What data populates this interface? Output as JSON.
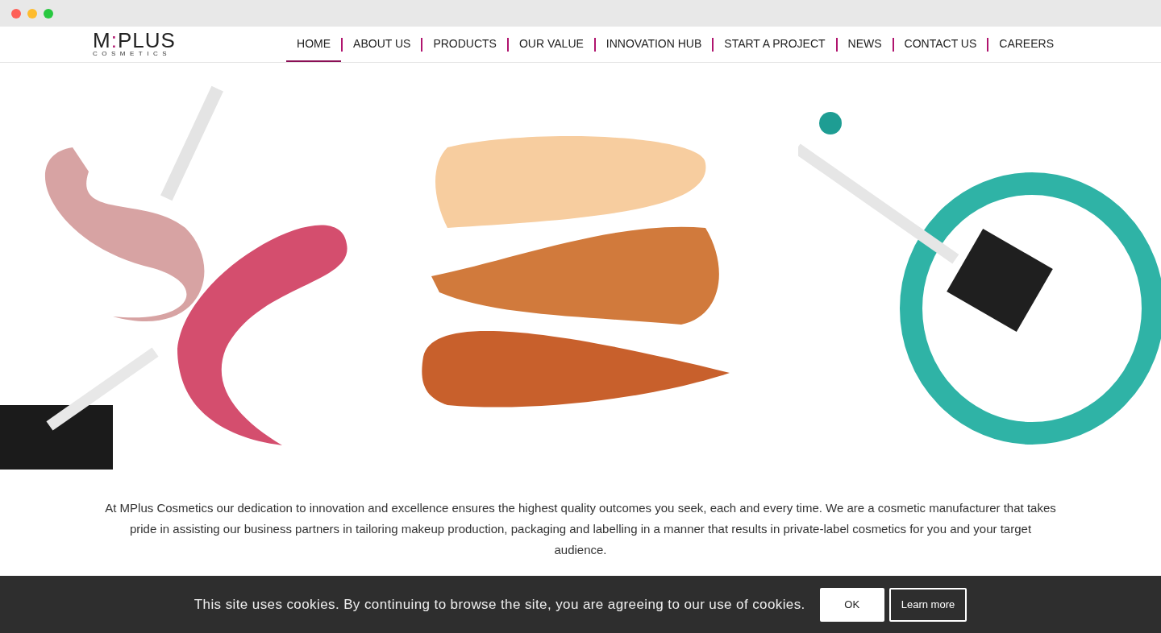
{
  "logo": {
    "name": "M:PLUS",
    "tagline": "COSMETICS"
  },
  "nav": [
    {
      "label": "HOME",
      "selected": true
    },
    {
      "label": "ABOUT US",
      "selected": false
    },
    {
      "label": "PRODUCTS",
      "selected": false
    },
    {
      "label": "OUR VALUE",
      "selected": false
    },
    {
      "label": "INNOVATION HUB",
      "selected": false
    },
    {
      "label": "START A PROJECT",
      "selected": false
    },
    {
      "label": "NEWS",
      "selected": false
    },
    {
      "label": "CONTACT US",
      "selected": false
    },
    {
      "label": "CAREERS",
      "selected": false
    }
  ],
  "intro": "At MPlus Cosmetics our dedication to innovation and excellence ensures the highest quality outcomes you seek, each and every time. We are a cosmetic manufacturer that takes pride in assisting our business partners in tailoring makeup production, packaging and labelling in a manner that results in private-label cosmetics for you and your target audience.",
  "cookie_bar": {
    "message": "This site uses cookies. By continuing to browse the site, you are agreeing to our use of cookies.",
    "buttons": [
      {
        "label": "OK",
        "kind": "primary"
      },
      {
        "label": "Learn more",
        "kind": "outline"
      }
    ]
  }
}
